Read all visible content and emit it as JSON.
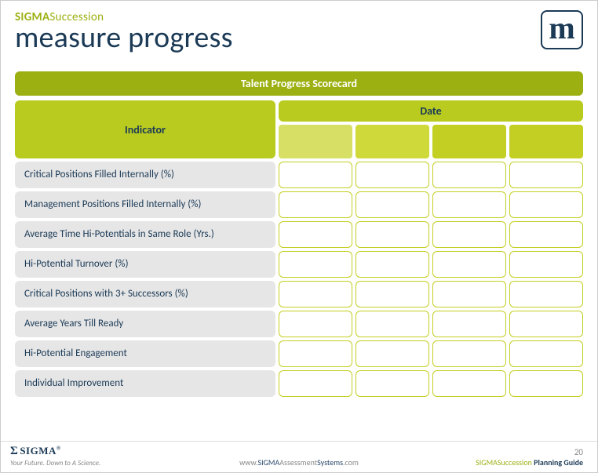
{
  "brand": {
    "prefix": "SIGMA",
    "suffix": "Succession"
  },
  "page_title": "measure progress",
  "badge_letter": "m",
  "scorecard_title": "Talent Progress Scorecard",
  "headers": {
    "indicator": "Indicator",
    "date": "Date"
  },
  "indicators": [
    "Critical Positions Filled Internally (%)",
    "Management Positions Filled Internally (%)",
    "Average Time Hi-Potentials in Same Role (Yrs.)",
    "Hi-Potential Turnover (%)",
    "Critical Positions with 3+ Successors (%)",
    "Average Years Till Ready",
    "Hi-Potential Engagement",
    "Individual Improvement"
  ],
  "footer": {
    "logo_text": "SIGMA",
    "tagline": "Your Future. Down to A Science.",
    "url_pre": "www.",
    "url_mid1": "SIGMA",
    "url_mid2": "Assessment",
    "url_mid3": "Systems",
    "url_post": ".com",
    "page_number": "20",
    "guide_olive": "SIGMASuccession",
    "guide_bold": "Planning Guide"
  }
}
